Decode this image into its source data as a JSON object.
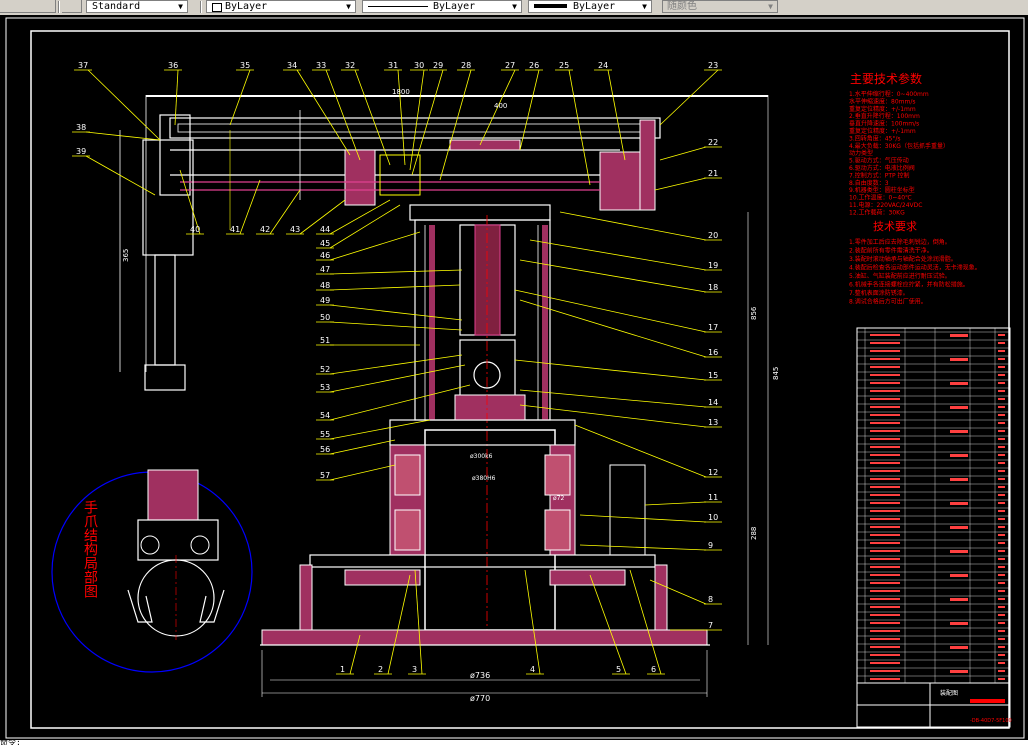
{
  "toolbar": {
    "text_style": "Standard",
    "layer": "ByLayer",
    "linetype": "ByLayer",
    "lineweight": "ByLayer",
    "plot_style": "随颜色"
  },
  "drawing": {
    "balloons_top": [
      "37",
      "36",
      "35",
      "34",
      "33",
      "32",
      "31",
      "30",
      "29",
      "28",
      "27",
      "26",
      "25",
      "24",
      "23"
    ],
    "balloons_left": [
      "38",
      "39"
    ],
    "balloons_right": [
      "22",
      "21",
      "20",
      "19",
      "18",
      "17",
      "16",
      "15",
      "14",
      "13",
      "12",
      "11",
      "10",
      "9",
      "8",
      "7"
    ],
    "balloons_left_column": [
      "46",
      "47",
      "48",
      "49",
      "50",
      "51",
      "52",
      "53",
      "54",
      "55",
      "56",
      "57"
    ],
    "balloons_lower": [
      "40",
      "41",
      "42",
      "43",
      "44",
      "45"
    ],
    "balloons_bottom": [
      "1",
      "2",
      "3",
      "4",
      "5",
      "6"
    ],
    "dims": {
      "base_inner": "ø736",
      "base_outer": "ø770",
      "arm_total": "1800",
      "arm_sub": "400",
      "height_total": "845",
      "height_mid": "856",
      "height_low": "288",
      "cyl_stroke": "365",
      "bore_a": "ø300k6",
      "bore_b": "ø380H6",
      "ring": "ø72"
    },
    "detail_label": "手爪结构局部图",
    "tech_params_title": "主要技术参数",
    "tech_params": [
      "1.水平伸缩行程：0~400mm",
      "  水平伸缩速度：80mm/s",
      "  重复定位精度：+/-1mm",
      "2.垂直升降行程：100mm",
      "  垂直升降速度：100mm/s",
      "  重复定位精度：+/-1mm",
      "3.回转角度：45°/s",
      "4.最大负载：30KG（包括抓手重量）",
      "         动力类型",
      "5.驱动方式：气压传动",
      "6.驱动方式：电液比例阀",
      "7.控制方式：PTP 控制",
      "8.自由度数：3",
      "9.机器类型：圆柱坐标型",
      "10.工作温度：0~40℃",
      "11.电源：220VAC/24VDC",
      "12.工作载荷：30KG"
    ],
    "tech_req_title": "技术要求",
    "tech_req": [
      "1.零件加工后应去除毛刺锐边，倒角。",
      "2.装配前所有零件需清洗干净。",
      "3.装配时滚动轴承与轴配合处涂润滑脂。",
      "4.装配后检查各运动部件运动灵活，无卡滞现象。",
      "5.油缸、气缸装配前应进行耐压试验。",
      "6.机械手各连接螺栓应拧紧，并有防松措施。",
      "7.整机表面涂防锈漆。",
      "8.调试合格后方可出厂使用。"
    ],
    "title_block": {
      "drawing_no": "-DB-40D7-5F100",
      "sheet_label": "装配图"
    }
  },
  "command_line": "命令:"
}
